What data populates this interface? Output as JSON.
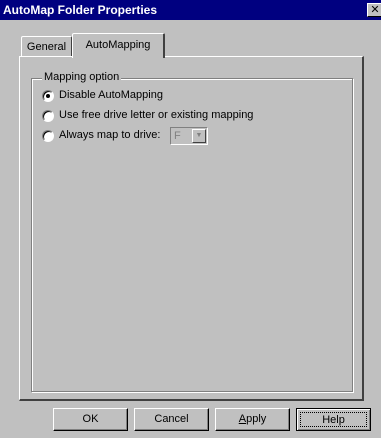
{
  "window": {
    "title": "AutoMap Folder Properties",
    "close_glyph": "✕"
  },
  "tabs": [
    {
      "label": "General",
      "active": false
    },
    {
      "label": "AutoMapping",
      "active": true
    }
  ],
  "mapping": {
    "group_label": "Mapping option",
    "options": [
      {
        "label": "Disable AutoMapping",
        "checked": true
      },
      {
        "label": "Use free drive letter or existing mapping",
        "checked": false
      },
      {
        "label": "Always map to drive:",
        "checked": false
      }
    ],
    "drive_value": "F",
    "drive_arrow": "▼"
  },
  "buttons": {
    "ok": "OK",
    "cancel": "Cancel",
    "apply_mnemonic": "A",
    "apply_rest": "pply",
    "help": "Help"
  },
  "colors": {
    "titlebar": "#000080",
    "face": "#c0c0c0"
  }
}
